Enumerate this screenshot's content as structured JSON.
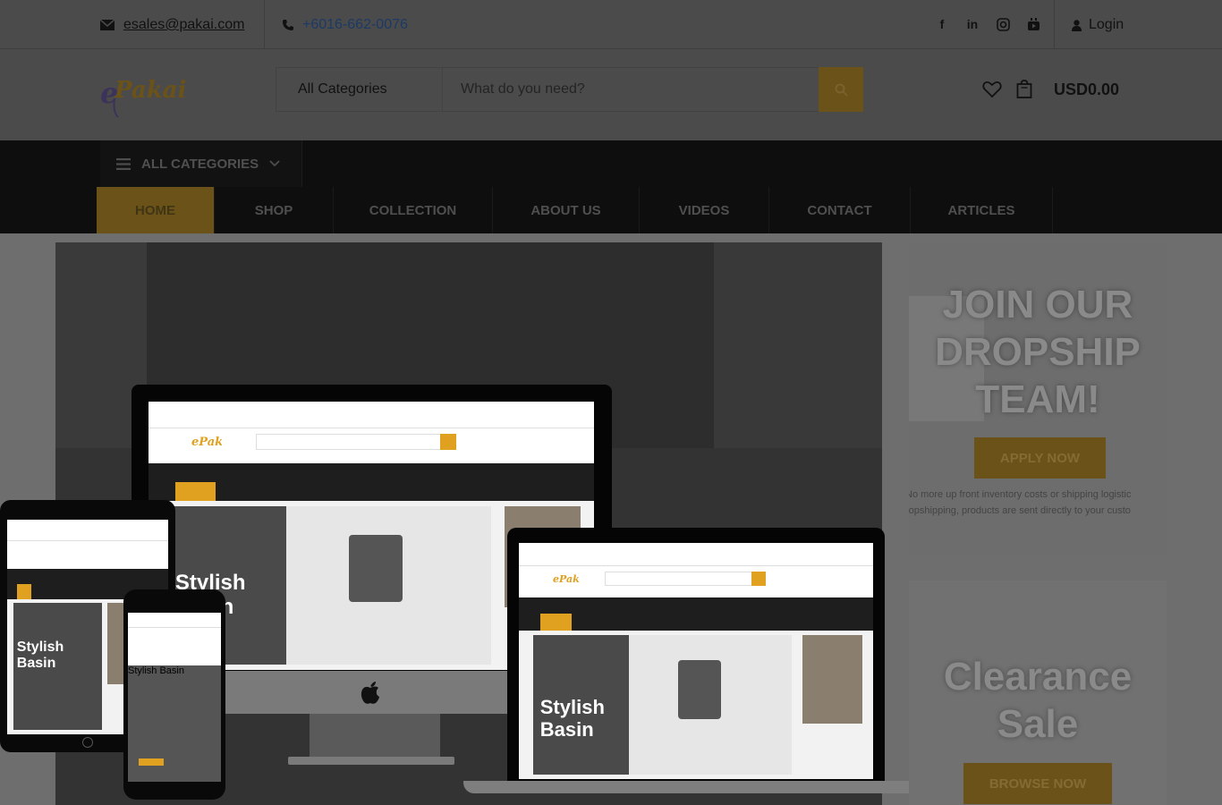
{
  "topbar": {
    "email": "esales@pakai.com",
    "phone": "+6016-662-0076",
    "social_icons": [
      "facebook-icon",
      "linkedin-icon",
      "instagram-icon",
      "youtube-icon"
    ],
    "login_label": "Login"
  },
  "header": {
    "logo_text": "ePakai",
    "category_select": "All Categories",
    "search_placeholder": "What do you need?",
    "cart_total": "USD0.00"
  },
  "nav": {
    "all_categories_label": "ALL CATEGORIES",
    "items": [
      "HOME",
      "SHOP",
      "COLLECTION",
      "ABOUT US",
      "VIDEOS",
      "CONTACT",
      "ARTICLES"
    ],
    "active": "HOME"
  },
  "hero": {
    "mockup_title_line1": "Stylish",
    "mockup_title_line2": "Basin"
  },
  "banners": [
    {
      "title": "JOIN OUR DROPSHIP TEAM!",
      "button": "APPLY NOW",
      "desc_line1": "No more up front inventory costs or shipping logistic",
      "desc_line2": "ropshipping, products are sent directly to your custo"
    },
    {
      "title": "Clearance Sale",
      "button": "BROWSE NOW"
    }
  ],
  "colors": {
    "accent": "#6b5218",
    "nav_bg": "#0e0e0e",
    "overlay_bg": "#4b4b4b"
  }
}
